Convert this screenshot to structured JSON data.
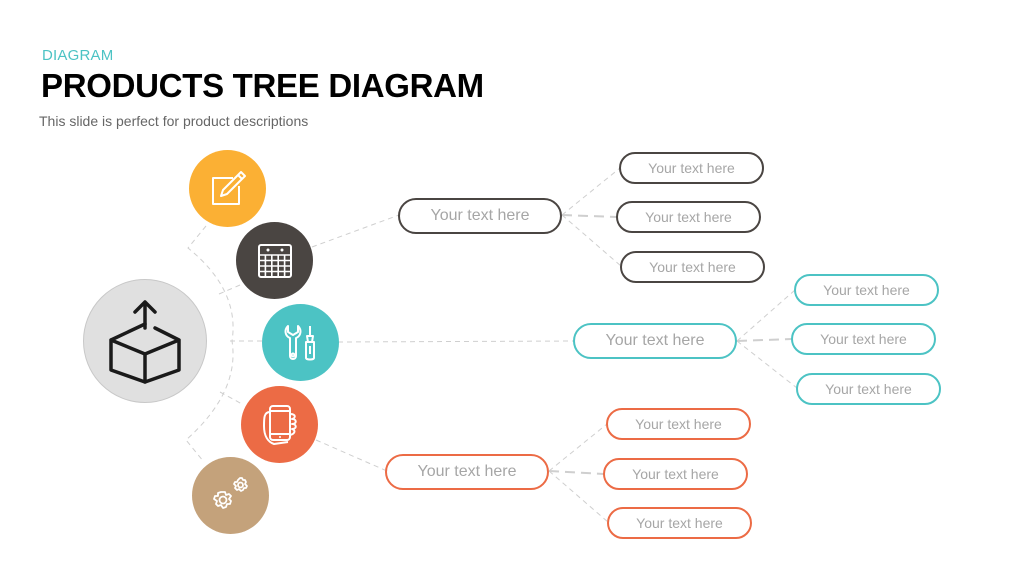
{
  "header": {
    "kicker": "DIAGRAM",
    "title": "PRODUCTS TREE DIAGRAM",
    "subtitle": "This slide is perfect for product descriptions"
  },
  "colors": {
    "accent": "#4cc3c4",
    "dark": "#4a4542",
    "orange": "#fbb034",
    "red": "#ec6b45",
    "tan": "#c4a27b",
    "hub": "#e0e0e0",
    "connector": "#cfcfcf",
    "placeholder_text": "#a6a6a6"
  },
  "hub": {
    "icon": "box-upload-icon"
  },
  "icon_nodes": [
    {
      "icon": "edit-pencil-icon",
      "color": "#fbb034"
    },
    {
      "icon": "calendar-icon",
      "color": "#4a4542"
    },
    {
      "icon": "tools-icon",
      "color": "#4cc3c4"
    },
    {
      "icon": "smartphone-hand-icon",
      "color": "#ec6b45"
    },
    {
      "icon": "gears-icon",
      "color": "#c4a27b"
    }
  ],
  "branches": [
    {
      "color": "#4a4542",
      "main": "Your text here",
      "leaves": [
        "Your text here",
        "Your text here",
        "Your text here"
      ]
    },
    {
      "color": "#4cc3c4",
      "main": "Your text here",
      "leaves": [
        "Your text here",
        "Your text here",
        "Your text here"
      ]
    },
    {
      "color": "#ec6b45",
      "main": "Your text here",
      "leaves": [
        "Your text here",
        "Your text here",
        "Your text here"
      ]
    }
  ]
}
